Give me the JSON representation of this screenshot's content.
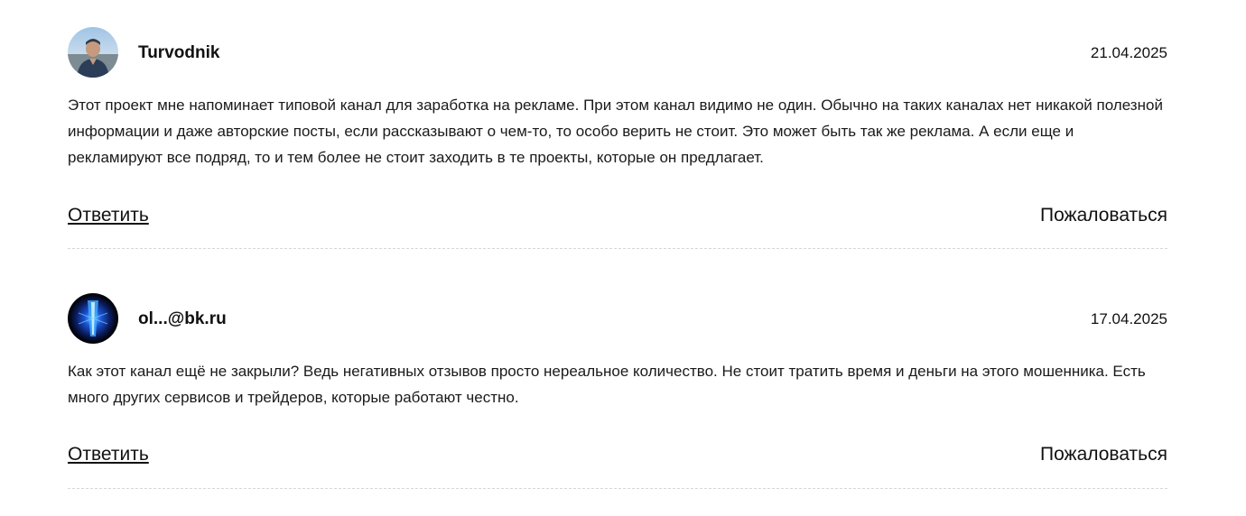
{
  "comments": [
    {
      "author": "Turvodnik",
      "date": "21.04.2025",
      "avatar_icon": "user-photo-avatar-icon",
      "text": "Этот проект мне напоминает типовой канал для заработка на рекламе. При этом канал видимо не один. Обычно на таких каналах нет никакой полезной информации и даже авторские посты, если рассказывают о чем-то, то особо верить не стоит. Это может быть так же реклама. А если еще и рекламируют все подряд, то и тем более не стоит заходить в те проекты, которые он предлагает.",
      "reply_label": "Ответить",
      "report_label": "Пожаловаться"
    },
    {
      "author": "ol...@bk.ru",
      "date": "17.04.2025",
      "avatar_icon": "abstract-blue-avatar-icon",
      "text": "Как этот канал ещё не закрыли? Ведь негативных отзывов просто нереальное количество. Не стоит тратить время и деньги на этого мошенника. Есть много других сервисов и трейдеров, которые работают честно.",
      "reply_label": "Ответить",
      "report_label": "Пожаловаться"
    }
  ],
  "colors": {
    "text": "#111111",
    "divider": "#d6d6d6",
    "background": "#ffffff"
  }
}
